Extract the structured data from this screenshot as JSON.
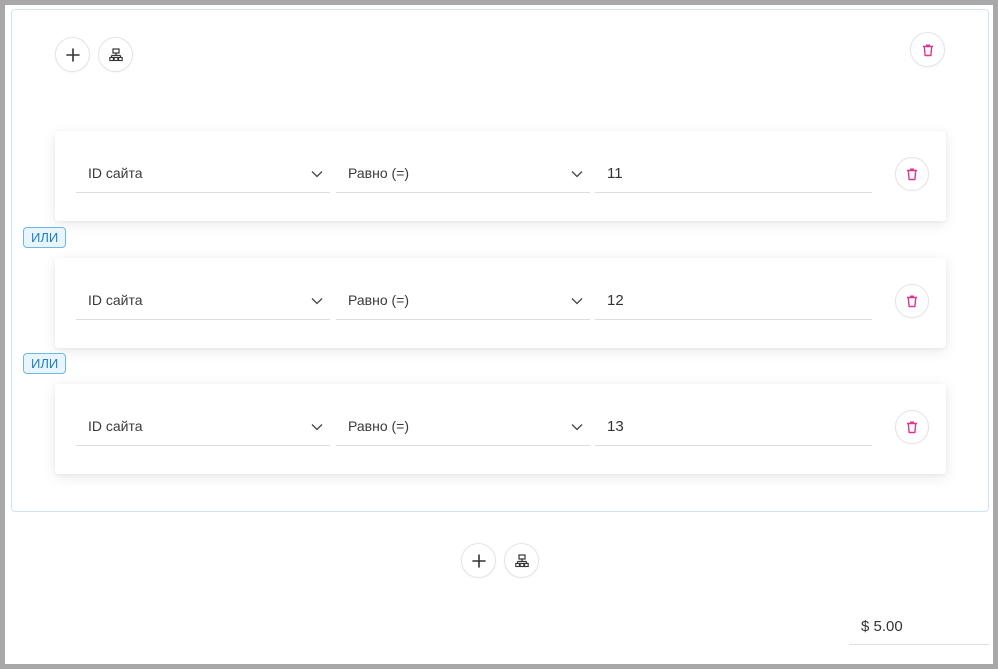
{
  "group": {
    "add_label": "+",
    "rules": [
      {
        "field": "ID сайта",
        "operator": "Равно (=)",
        "value": "11"
      },
      {
        "field": "ID сайта",
        "operator": "Равно (=)",
        "value": "12"
      },
      {
        "field": "ID сайта",
        "operator": "Равно (=)",
        "value": "13"
      }
    ],
    "or_labels": [
      "ИЛИ",
      "ИЛИ"
    ]
  },
  "bottom": {
    "add_label": "+"
  },
  "price": {
    "value": "$ 5.00"
  },
  "colors": {
    "delete_icon": "#e0338f",
    "or_badge_text": "#1e7fc0",
    "or_badge_border": "#6fb7e0",
    "group_border": "#cfe6f5"
  }
}
